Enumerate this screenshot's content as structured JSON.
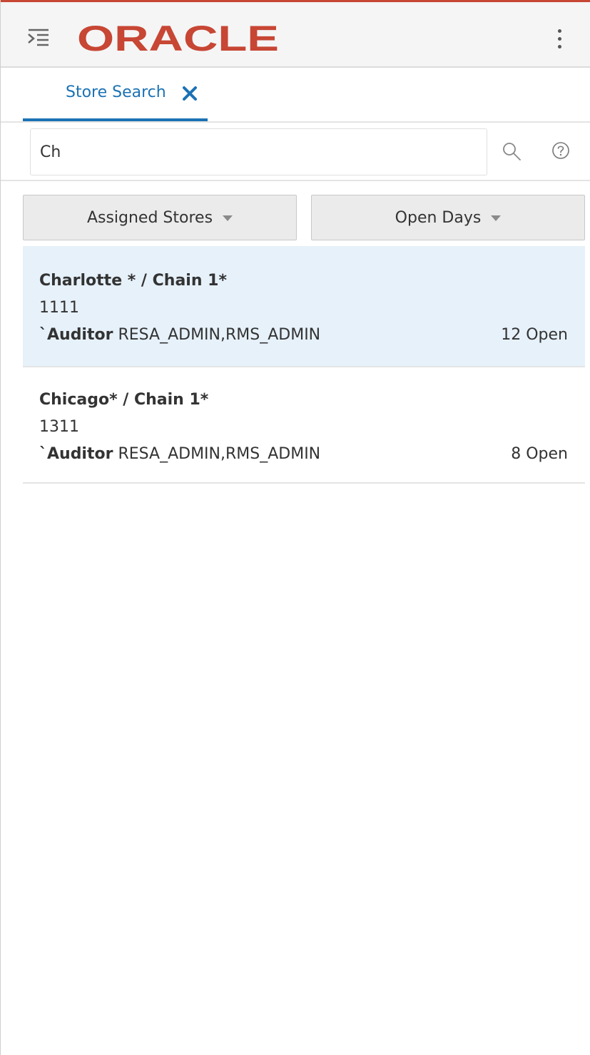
{
  "header": {
    "logo_text": "ORACLE",
    "logo_color": "#C74634",
    "menu_icon": "hamburger-menu-icon",
    "more_icon": "kebab-menu-icon"
  },
  "tabs": [
    {
      "label": "Store Search",
      "active": true,
      "close_icon": "close-icon"
    }
  ],
  "search": {
    "value": "Ch",
    "search_icon": "search-icon",
    "help_icon": "help-icon"
  },
  "filters": [
    {
      "label": "Assigned Stores",
      "icon": "caret-down-icon"
    },
    {
      "label": "Open Days",
      "icon": "caret-down-icon"
    }
  ],
  "results": [
    {
      "title": "Charlotte * / Chain 1*",
      "store_id": "1111",
      "role": "`Auditor",
      "users": "RESA_ADMIN,RMS_ADMIN",
      "open": "12 Open",
      "selected": true
    },
    {
      "title": "Chicago* / Chain 1*",
      "store_id": "1311",
      "role": "`Auditor",
      "users": "RESA_ADMIN,RMS_ADMIN",
      "open": "8 Open",
      "selected": false
    }
  ],
  "colors": {
    "accent": "#1B72B4",
    "brand": "#C74634",
    "selected_row": "#E6F1FA"
  }
}
